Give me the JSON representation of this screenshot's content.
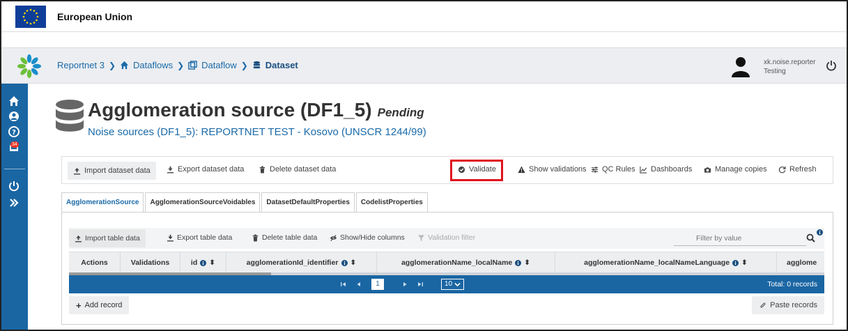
{
  "eu_bar": {
    "title": "European Union"
  },
  "breadcrumb": {
    "items": [
      "Reportnet 3",
      "Dataflows",
      "Dataflow",
      "Dataset"
    ]
  },
  "user": {
    "name": "xk.noise.reporter",
    "role": "Testing"
  },
  "sidebar": {
    "notification_count": "34"
  },
  "dataset": {
    "title": "Agglomeration source (DF1_5)",
    "status": "Pending",
    "subtitle": "Noise sources (DF1_5): REPORTNET TEST - Kosovo (UNSCR 1244/99)"
  },
  "toolbar": {
    "import": "Import dataset data",
    "export": "Export dataset data",
    "delete": "Delete dataset data",
    "validate": "Validate",
    "show_validations": "Show validations",
    "qc_rules": "QC Rules",
    "dashboards": "Dashboards",
    "manage_copies": "Manage copies",
    "refresh": "Refresh"
  },
  "tabs": [
    {
      "label": "AgglomerationSource"
    },
    {
      "label": "AgglomerationSourceVoidables"
    },
    {
      "label": "DatasetDefaultProperties"
    },
    {
      "label": "CodelistProperties"
    }
  ],
  "table_toolbar": {
    "import": "Import table data",
    "export": "Export table data",
    "delete": "Delete table data",
    "show_hide": "Show/Hide columns",
    "validation_filter": "Validation filter",
    "filter_placeholder": "Filter by value"
  },
  "columns": [
    "Actions",
    "Validations",
    "id",
    "agglomerationId_identifier",
    "agglomerationName_localName",
    "agglomerationName_localNameLanguage",
    "agglome"
  ],
  "paginator": {
    "current_page": "1",
    "rows_per_page": "10",
    "total": "Total: 0 records"
  },
  "footer": {
    "add_record": "Add record",
    "paste_records": "Paste records"
  },
  "colors": {
    "primary": "#1a66a3",
    "validate_highlight": "#e0141e",
    "eu_blue": "#0f3e99"
  }
}
